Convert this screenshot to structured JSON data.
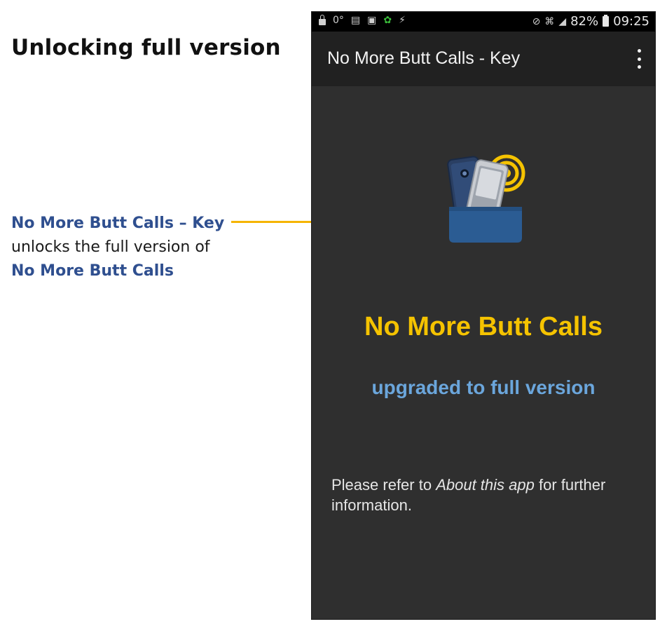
{
  "slide": {
    "title": "Unlocking full version",
    "callout_key": "No More Butt Calls – Key",
    "callout_text": "unlocks the full version of",
    "callout_app": "No More Butt Calls"
  },
  "status_bar": {
    "left_glyphs": [
      "lock-icon",
      "0°",
      "sim-icon",
      "gallery-icon",
      "android-icon",
      "bolt-icon"
    ],
    "temperature": "0°",
    "right_glyphs": [
      "mute-icon",
      "wifi-icon",
      "signal-icon"
    ],
    "battery": "82%",
    "time": "09:25"
  },
  "app_bar": {
    "title": "No More Butt Calls - Key",
    "menu_icon": "overflow-menu-icon"
  },
  "content": {
    "icon": "phones-in-pocket-icon",
    "app_name": "No More Butt Calls",
    "status": "upgraded to full version",
    "info_prefix": "Please refer to ",
    "info_link": "About this app",
    "info_suffix": " for further information."
  },
  "colors": {
    "accent_yellow": "#f5c300",
    "accent_blue": "#6ba6dc",
    "callout_blue": "#2f4f8f",
    "connector": "#f5b400",
    "screen_bg": "#2f2f2f",
    "app_bar_bg": "#212121"
  }
}
